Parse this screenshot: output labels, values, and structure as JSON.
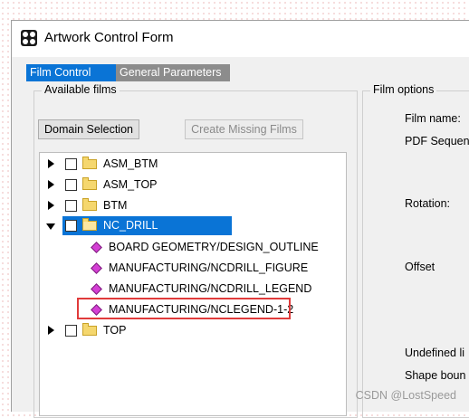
{
  "window": {
    "title": "Artwork Control Form",
    "icon": "app-icon"
  },
  "tabs": [
    {
      "label": "Film Control",
      "active": true
    },
    {
      "label": "General Parameters",
      "active": false
    }
  ],
  "available_films": {
    "group_label": "Available films",
    "domain_selection_label": "Domain Selection",
    "create_missing_label": "Create Missing Films",
    "tree": [
      {
        "label": "ASM_BTM",
        "expanded": false,
        "checked": false
      },
      {
        "label": "ASM_TOP",
        "expanded": false,
        "checked": false
      },
      {
        "label": "BTM",
        "expanded": false,
        "checked": false
      },
      {
        "label": "NC_DRILL",
        "expanded": true,
        "checked": false,
        "selected": true,
        "children": [
          "BOARD GEOMETRY/DESIGN_OUTLINE",
          "MANUFACTURING/NCDRILL_FIGURE",
          "MANUFACTURING/NCDRILL_LEGEND",
          "MANUFACTURING/NCLEGEND-1-2"
        ]
      },
      {
        "label": "TOP",
        "expanded": false,
        "checked": false
      }
    ],
    "highlighted_item": "MANUFACTURING/NCLEGEND-1-2",
    "highlight_color": "#e03b3b"
  },
  "film_options": {
    "group_label": "Film options",
    "film_name_label": "Film name:",
    "pdf_sequence_label": "PDF Sequenc",
    "rotation_label": "Rotation:",
    "offset_label": "Offset",
    "undefined_label": "Undefined li",
    "shape_bound_label": "Shape boun"
  },
  "watermark": "CSDN @LostSpeed",
  "colors": {
    "accent": "#0a74d6",
    "inactive_tab": "#8c8c8c",
    "folder": "#f5d76e",
    "leaf": "#d43fd4"
  }
}
